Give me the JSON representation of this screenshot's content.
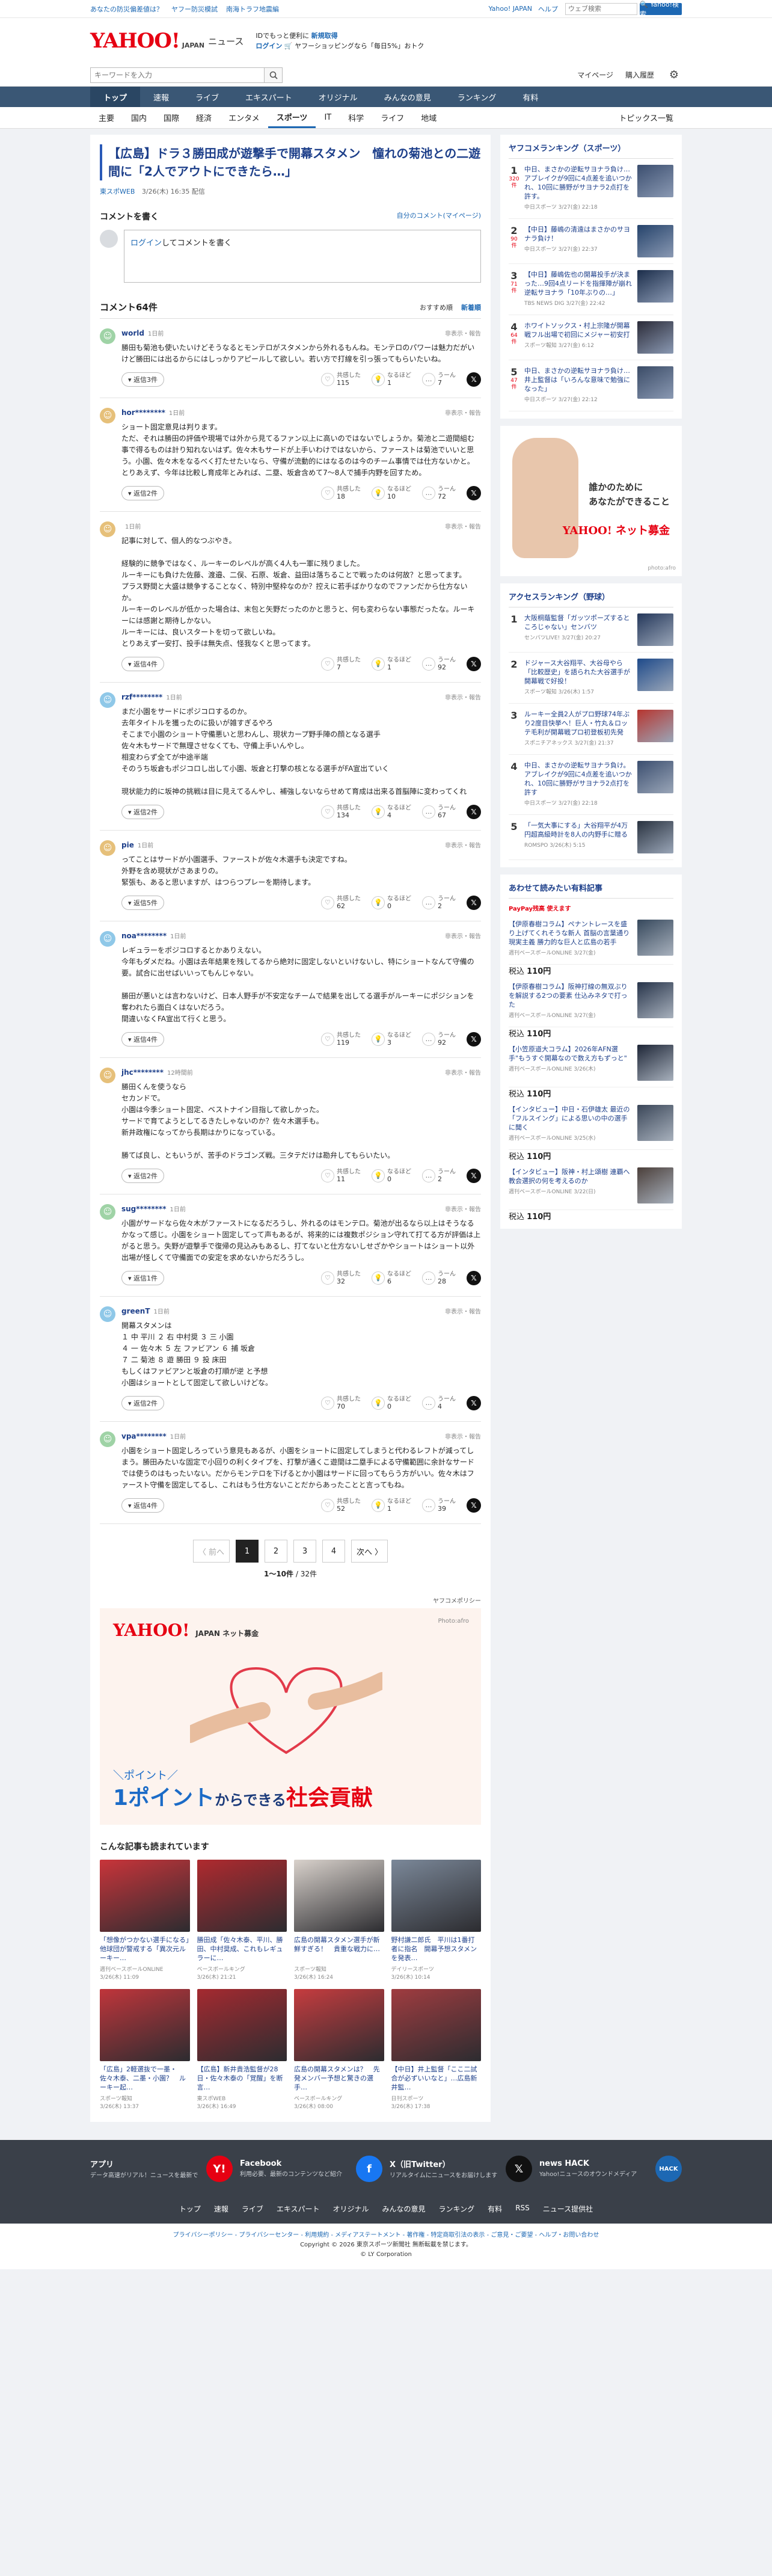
{
  "top_strip": {
    "links": [
      "あなたの防災偏差値は？",
      "ヤフー防災模試",
      "南海トラフ地震編"
    ],
    "right_links": [
      "Yahoo! JAPAN",
      "ヘルプ"
    ],
    "search_placeholder": "ウェブ検索",
    "search_button": "🔍 Yahoo!検索"
  },
  "header": {
    "logo": "YAHOO!",
    "logo_sub": "JAPAN",
    "service": "ニュース",
    "promo_line1_a": "IDでもっと便利に",
    "promo_line1_b": "新規取得",
    "promo_line2_a": "ログイン",
    "promo_line2_b": "ヤフーショッピングなら「毎日5%」おトク"
  },
  "search_row": {
    "placeholder": "キーワードを入力",
    "links": [
      "マイページ",
      "購入履歴"
    ]
  },
  "nav": {
    "items": [
      "トップ",
      "速報",
      "ライブ",
      "エキスパート",
      "オリジナル",
      "みんなの意見",
      "ランキング",
      "有料"
    ],
    "active": 0
  },
  "subnav": {
    "items": [
      "主要",
      "国内",
      "国際",
      "経済",
      "エンタメ",
      "スポーツ",
      "IT",
      "科学",
      "ライフ",
      "地域"
    ],
    "active": 5,
    "right": "トピックス一覧"
  },
  "article": {
    "title": "【広島】ドラ３勝田成が遊撃手で開幕スタメン　憧れの菊池との二遊間に「2人でアウトにできたら…」",
    "source": "東スポWEB",
    "date": "3/26(木) 16:35 配信"
  },
  "write": {
    "title": "コメントを書く",
    "my_comments": "自分のコメント(マイページ)",
    "box_login": "ログイン",
    "box_rest": "してコメントを書く"
  },
  "comments_header": {
    "count": "コメント64件",
    "sort_options": [
      "おすすめ順",
      "新着順"
    ],
    "active_sort": 1
  },
  "comment_ui": {
    "reply_label": "返信",
    "report": "非表示・報告",
    "reactions": [
      "共感した",
      "なるほど",
      "うーん"
    ]
  },
  "comments": [
    {
      "user": "world",
      "time": "1日前",
      "text": "勝田も菊池も使いたいけどそうなるとモンテロがスタメンから外れるもんね。モンテロのパワーは魅力だがいけど勝田には出るからにはしっかりアピールして欲しい。若い方で打線を引っ張ってもらいたいね。",
      "replies": "返信3件",
      "r1": "115",
      "r2": "1",
      "r3": "7",
      "color": "#9fd3a6"
    },
    {
      "user": "hor********",
      "time": "1日前",
      "text": "ショート固定意見は判ります。\nただ、それは勝田の評価や現場では外から見てるファン以上に高いのではないでしょうか。菊池と二遊間組む事で得るものは計り知れないはず。佐々木もサードが上手いわけではないから、ファーストは菊池でいいと思う。小園、佐々木をなるべく打たせたいなら、守備が流動的にはなるのは今のチーム事情では仕方ないかと。とりあえず、今年は比較し育成年とみれば、二塁、坂倉含めて7〜8人で捕手内野を回すため。",
      "replies": "返信2件",
      "r1": "18",
      "r2": "10",
      "r3": "72",
      "color": "#e6c07a"
    },
    {
      "user": "",
      "time": "1日前",
      "text": "記事に対して、個人的なつぶやき。\n\n経験的に競争ではなく、ルーキーのレベルが高く4人も一軍に残りました。\nルーキーにも負けた佐藤、渡邉、二俣、石原、坂倉、益田は落ちることで戦ったのは何故？と思ってます。\nプラス野間と大盛は競争することなく、特別中堅枠なのか？控えに若手ばかりなのでファンだから仕方ないか。\nルーキーのレベルが低かった場合は、末包と矢野だったのかと思うと、何も変わらない事態だったな。ルーキーには感謝と期待しかない。\nルーキーには、良いスタートを切って欲しいね。\nとりあえず一安打、投手は無失点、怪我なくと思ってます。",
      "replies": "返信4件",
      "r1": "7",
      "r2": "1",
      "r3": "92",
      "color": "#e6c07a"
    },
    {
      "user": "rzf********",
      "time": "1日前",
      "text": "まだ小園をサードにポジコロするのか。\n去年タイトルを獲ったのに扱いが雑すぎるやろ\nそこまで小園のショート守備悪いと思わんし、現状カープ野手陣の顔となる選手\n佐々木もサードで無理させなくても、守備上手いんやし。\n相変わらず全てが中途半端\nそのうち坂倉もポジコロし出して小園、坂倉と打撃の核となる選手がFA宣出ていく\n\n現状能力的に坂神の挑戦は目に見えてるんやし、補強しないならせめて育成は出来る首脳陣に変わってくれ",
      "replies": "返信2件",
      "r1": "134",
      "r2": "4",
      "r3": "67",
      "color": "#8fc8e8"
    },
    {
      "user": "pie",
      "time": "1日前",
      "text": "ってことはサードが小園選手、ファーストが佐々木選手も決定ですね。\n外野を含め現状がさあまりの。\n緊張も、あると思いますが、はつらつプレーを期待します。",
      "replies": "返信5件",
      "r1": "62",
      "r2": "0",
      "r3": "2",
      "color": "#e6c07a"
    },
    {
      "user": "noa********",
      "time": "1日前",
      "text": "レギュラーをポジコロするとかありえない。\n今年もダメだね。小園は去年結果を残してるから絶対に固定しないといけないし、特にショートなんて守備の要。試合に出せばいいってもんじゃない。\n\n勝田が悪いとは言わないけど、日本人野手が不安定なチームで結果を出してる選手がルーキーにポジションを奪われたら面白くはないだろう。\n間違いなくFA宣出て行くと思う。",
      "replies": "返信4件",
      "r1": "119",
      "r2": "3",
      "r3": "92",
      "color": "#8fc8e8"
    },
    {
      "user": "jhc********",
      "time": "12時間前",
      "text": "勝田くんを使うなら\nセカンドで。\n小園は今季ショート固定、ベストナイン目指して欲しかった。\nサードで育てようとしてるきたしゃないのか？佐々木選手も。\n新井政権になってから長期はかりになっている。\n\n勝てば良し、ともいうが、苦手のドラゴンズ戦。三タテだけは勘弁してもらいたい。",
      "replies": "返信2件",
      "r1": "11",
      "r2": "0",
      "r3": "2",
      "color": "#e6c07a"
    },
    {
      "user": "sug********",
      "time": "1日前",
      "text": "小園がサードなら佐々木がファーストになるだろうし、外れるのはモンテロ。菊池が出るなら以上はそうなるかなって感じ。小園をショート固定してって声もあるが、将来的には複数ポジション守れて打てる方が評価は上がると思う。失野が遊撃手で復帰の見込みもあるし、打てないと仕方ないしせざかやショートはショート以外出場が怪しくて守備面での安定を求めないからだろうし。",
      "replies": "返信1件",
      "r1": "32",
      "r2": "6",
      "r3": "28",
      "color": "#9fd3a6"
    },
    {
      "user": "greenT",
      "time": "1日前",
      "text": "開幕スタメンは\n１ 中 平川 ２ 右 中村奨 ３ 三 小園\n４ 一 佐々木 ５ 左 ファビアン ６ 捕 坂倉\n７ 二 菊池 ８ 遊 勝田 ９ 投 床田\nもしくはファビアンと坂倉の打順が逆 と予想\n小園はショートとして固定して欲しいけどな。",
      "replies": "返信2件",
      "r1": "70",
      "r2": "0",
      "r3": "4",
      "color": "#8fc8e8"
    },
    {
      "user": "vpa********",
      "time": "1日前",
      "text": "小園をショート固定しろっていう意見もあるが、小園をショートに固定してしまうと代わるレフトが減ってしまう。勝田みたいな固定で小回りの利くタイプを、打撃が通くこ遊間は二塁手による守備範囲に余計なサードでは使うのはもったいない。だからモンテロを下げるとか小園はサードに回ってもらう方がいい。佐々木はファースト守備を固定してるし、これはもう仕方ないことだからあったことと言ってもね。",
      "replies": "返信4件",
      "r1": "52",
      "r2": "1",
      "r3": "39",
      "color": "#9fd3a6"
    }
  ],
  "pager": {
    "prev": "〈 前へ",
    "pages": [
      "1",
      "2",
      "3",
      "4"
    ],
    "next": "次へ 〉",
    "info_range": "1〜10件",
    "info_total": "/ 32件"
  },
  "policy": "ヤフコメポリシー",
  "ad": {
    "logo": "YAHOO!",
    "logo_sub": "JAPAN ネット募金",
    "photo": "Photo:afro",
    "tagline": "＼ポイント／",
    "big_a": "1ポイント",
    "big_b": "からできる",
    "big_c": "社会貢献"
  },
  "also_read": {
    "title": "こんな記事も読まれています",
    "items": [
      {
        "title": "「想像がつかない選手になる」他球団が警戒する「異次元ルーキー…",
        "src": "週刊ベースボールONLINE",
        "date": "3/26(木) 11:09",
        "color": "#c9343a"
      },
      {
        "title": "勝田成「佐々木泰、平川、勝田、中村奨成、これもレギュラーに…",
        "src": "ベースボールキング",
        "date": "3/26(木) 21:21",
        "color": "#b02a2f"
      },
      {
        "title": "広島の開幕スタメン選手が新鮮すぎる！　貴重な戦力に…",
        "src": "スポーツ報知",
        "date": "3/26(木) 16:24",
        "color": "#d9d2cc"
      },
      {
        "title": "野村謙二郎氏　平川は1番打者に指名　開幕予想スタメンを発表…",
        "src": "デイリースポーツ",
        "date": "3/26(木) 10:14",
        "color": "#7b8899"
      },
      {
        "title": "「広島」2軽選抜で一墨・佐々木泰、二墨・小園？　ルーキー起…",
        "src": "スポーツ報知",
        "date": "3/26(木) 13:37",
        "color": "#c0353b"
      },
      {
        "title": "【広島】新井貴浩監督が28日・佐々木泰の「覚醒」を断言…",
        "src": "東スポWEB",
        "date": "3/26(木) 16:49",
        "color": "#a52a30"
      },
      {
        "title": "広島の開幕スタメンは？　先発メンバー予想と驚きの選手…",
        "src": "ベースボールキング",
        "date": "3/26(木) 08:00",
        "color": "#c63c3f"
      },
      {
        "title": "【中日】井上監督「ここ二試合が必ずいいなと」…広島新井監…",
        "src": "日刊スポーツ",
        "date": "3/26(木) 17:38",
        "color": "#a03c40"
      }
    ]
  },
  "side_ranking": {
    "title": "ヤフコメランキング（スポーツ）",
    "items": [
      {
        "num": "1",
        "count": "320件",
        "text": "中日、まさかの逆転サヨナラ負け…アブレイクが9回に4点差を追いつかれ、10回に勝野がサヨナラ2点打を許す。",
        "src": "中日スポーツ 3/27(金) 22:18",
        "color": "#3b4e6f"
      },
      {
        "num": "2",
        "count": "90件",
        "text": "【中日】藤嶋の清遠はまさかのサヨナラ負け！",
        "src": "中日スポーツ 3/27(金) 22:37",
        "color": "#25436b"
      },
      {
        "num": "3",
        "count": "71件",
        "text": "【中日】藤嶋佐也の開幕投手が決まった…9回4点リードを指揮陣が崩れ逆転サヨナラ「10年ぶりの…」",
        "src": "TBS NEWS DIG 3/27(金) 22:42",
        "color": "#1b2d4a"
      },
      {
        "num": "4",
        "count": "64件",
        "text": "ホワイトソックス・村上宗隆が開幕戦フル出場で初回にメジャー初安打",
        "src": "スポーツ報知 3/27(金) 6:12",
        "color": "#2b2b38"
      },
      {
        "num": "5",
        "count": "47件",
        "text": "中日、まさかの逆転サヨナラ負け…井上監督は「いろんな意味で勉強になった」",
        "src": "中日スポーツ 3/27(金) 22:12",
        "color": "#3a4b66"
      }
    ]
  },
  "side_ad": {
    "msg_l1": "誰かのために",
    "msg_l2": "あなたができること",
    "logo": "YAHOO! ネット募金",
    "photo": "photo:afro"
  },
  "side_access": {
    "title": "アクセスランキング（野球）",
    "items": [
      {
        "num": "1",
        "text": "大阪桐蔭監督「ガッツポーズするところじゃない」センバツ",
        "src": "センバツLIVE! 3/27(金) 20:27",
        "color": "#24375a"
      },
      {
        "num": "2",
        "text": "ドジャース大谷翔平、大谷母やら「比較歴史」を語られた大谷選手が開幕戦で好投！",
        "src": "スポーツ報知 3/26(木) 1:57",
        "color": "#1e4a8a"
      },
      {
        "num": "3",
        "text": "ルーキー全員2人がプロ野球74年ぶり2度目快挙へ！巨人・竹丸＆ロッテ毛利が開幕戦プロ初登板初先発",
        "src": "スポニチアネックス 3/27(金) 21:37",
        "color": "#b7352f"
      },
      {
        "num": "4",
        "text": "中日、まさかの逆転サヨナラ負け。アブレイクが9回に4点差を追いつかれ、10回に勝野がサヨナラ2点打を許す",
        "src": "中日スポーツ 3/27(金) 22:18",
        "color": "#3b4e6f"
      },
      {
        "num": "5",
        "text": "「一気大事にする」大谷翔平が4万円超高級時計を8人の内野手に贈る",
        "src": "ROMSPO 3/26(木) 5:15",
        "color": "#29323f"
      }
    ]
  },
  "side_alt": {
    "title": "あわせて読みたい有料記事",
    "badge": "PayPay残高 使えます",
    "items": [
      {
        "text": "【伊原春樹コラム】ペナントレースを盛り上げてくれそうな新人 首脳の言葉通り現実主義 勝力的な巨人と広島の若手",
        "src": "週刊ベースボールONLINE 3/27(金)",
        "price": "110円",
        "color": "#36485c"
      },
      {
        "text": "【伊原春樹コラム】阪神打線の無双ぶりを解説する2つの要素 仕込みネタで打った",
        "src": "週刊ベースボールONLINE 3/27(金)",
        "price": "110円",
        "color": "#27344a"
      },
      {
        "text": "【小笠原道大コラム】2026年AFN選手\"もうすぐ開幕なので数え方もずっと\"",
        "src": "週刊ベースボールONLINE 3/26(木)",
        "price": "110円",
        "color": "#1d2536"
      },
      {
        "text": "【インタビュー】中日・石伊雄太 最近の「フルスイング」による思いの中の選手に聞く",
        "src": "週刊ベースボールONLINE 3/25(水)",
        "price": "110円",
        "color": "#3a4658"
      },
      {
        "text": "【インタビュー】阪神・村上頌樹 連覇へ教会選択の何を考えるのか",
        "src": "週刊ベースボールONLINE 3/22(日)",
        "price": "110円",
        "color": "#4b3f3a"
      }
    ]
  },
  "footer": {
    "apps": [
      {
        "title": "アプリ",
        "desc": "データ高速がリアル！ニュースを最新で",
        "icon": "Y!",
        "color": "#e60012"
      },
      {
        "title": "Facebook",
        "desc": "利用必要、最新のコンテンツなど紹介",
        "icon": "f",
        "color": "#1877f2"
      },
      {
        "title": "X（旧Twitter）",
        "desc": "リアルタイムにニュースをお届けします",
        "icon": "𝕏",
        "color": "#111111"
      },
      {
        "title": "news HACK",
        "desc": "Yahoo!ニュースのオウンドメディア",
        "icon": "HACK",
        "color": "#1d68b3"
      }
    ],
    "nav": [
      "トップ",
      "速報",
      "ライブ",
      "エキスパート",
      "オリジナル",
      "みんなの意見",
      "ランキング",
      "有料",
      "RSS",
      "ニュース提供社"
    ],
    "links": "プライバシーポリシー - プライバシーセンター - 利用規約 - メディアステートメント - 著作権 - 特定商取引法の表示 - ご意見・ご要望 - ヘルプ・お問い合わせ",
    "copyright": "Copyright © 2026 東京スポーツ新聞社 無断転載を禁じます。",
    "corp": "© LY Corporation"
  }
}
